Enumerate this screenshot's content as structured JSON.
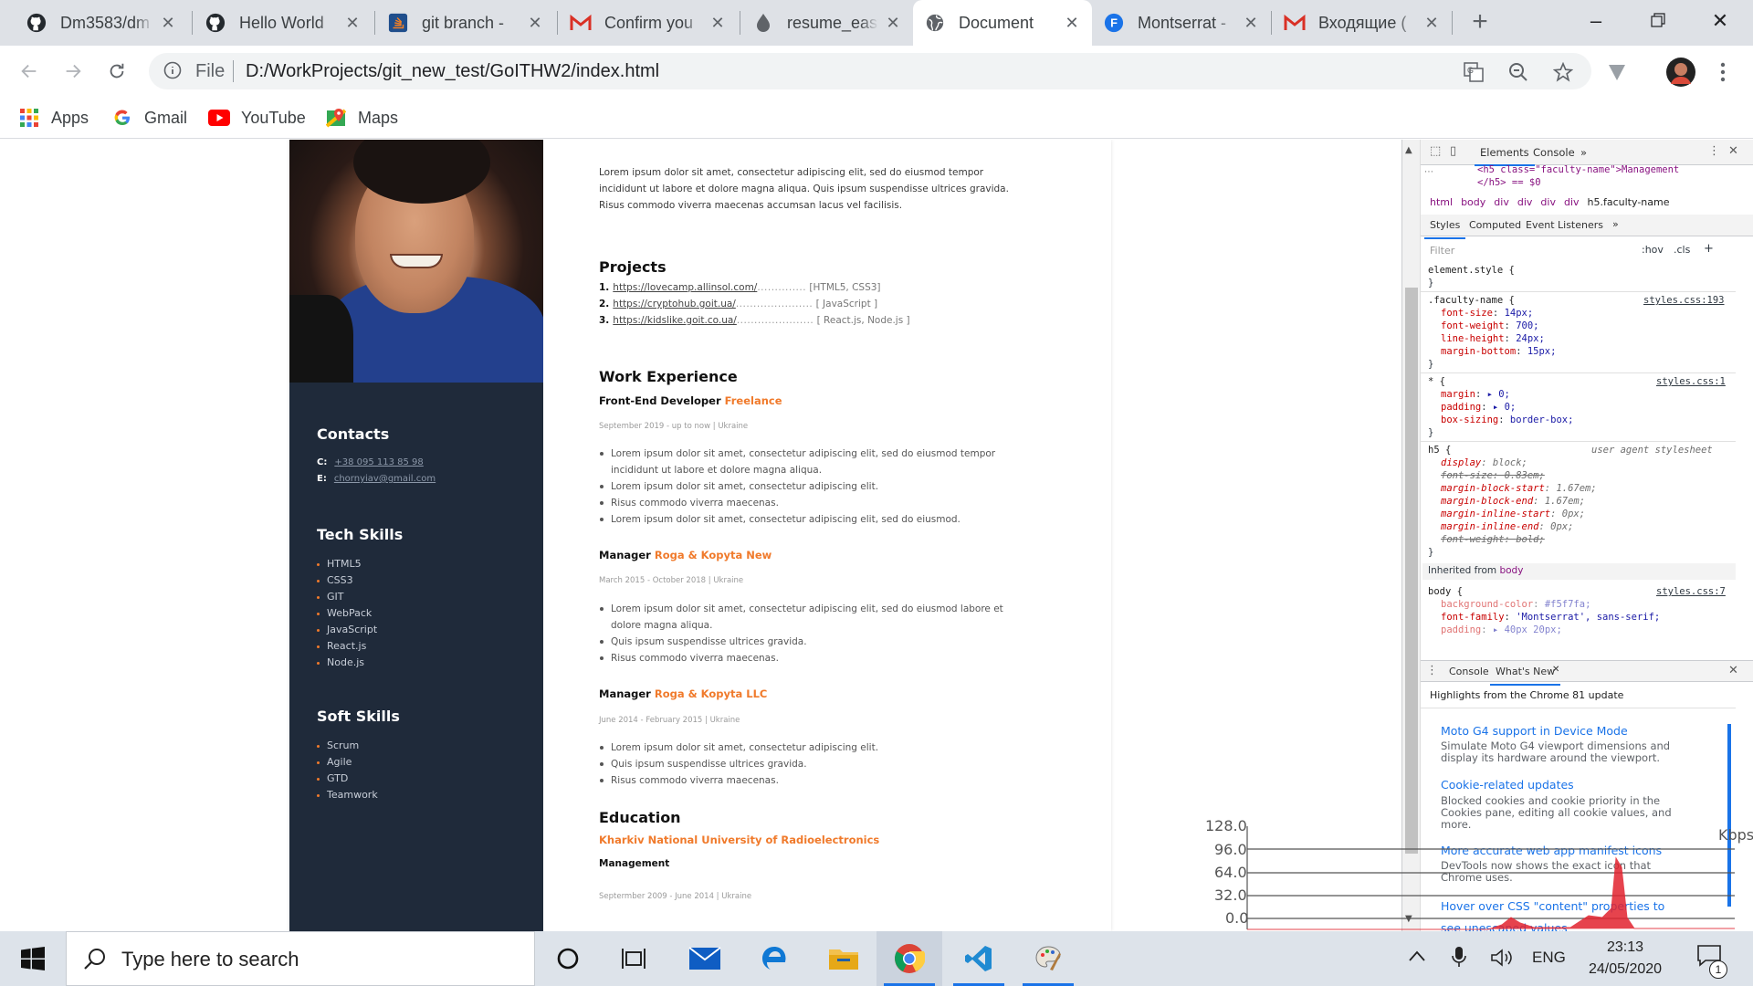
{
  "tabs": [
    {
      "title": "Dm3583/dm",
      "icon": "github-icon"
    },
    {
      "title": "Hello World",
      "icon": "github-icon"
    },
    {
      "title": "git branch -",
      "icon": "stackoverflow-icon"
    },
    {
      "title": "Confirm you",
      "icon": "gmail-icon"
    },
    {
      "title": "resume_easy",
      "icon": "drop-icon"
    },
    {
      "title": "Document",
      "icon": "globe-icon",
      "active": true
    },
    {
      "title": "Montserrat -",
      "icon": "fonts-icon"
    },
    {
      "title": "Входящие (",
      "icon": "gmail-icon"
    }
  ],
  "address": {
    "scheme": "File",
    "url": "D:/WorkProjects/git_new_test/GoITHW2/index.html"
  },
  "bookmarks": [
    {
      "label": "Apps",
      "icon": "apps-grid-icon"
    },
    {
      "label": "Gmail",
      "icon": "google-icon"
    },
    {
      "label": "YouTube",
      "icon": "youtube-icon"
    },
    {
      "label": "Maps",
      "icon": "maps-icon"
    }
  ],
  "resume": {
    "intro": "Lorem ipsum dolor sit amet, consectetur adipiscing elit, sed do eiusmod tempor incididunt ut labore et dolore magna aliqua. Quis ipsum suspendisse ultrices gravida. Risus commodo viverra maecenas accumsan lacus vel facilisis.",
    "contacts_title": "Contacts",
    "contacts": [
      {
        "key": "C:",
        "value": "+38 095 113 85 98"
      },
      {
        "key": "E:",
        "value": "chornyiav@gmail.com"
      }
    ],
    "tech_title": "Tech Skills",
    "tech_skills": [
      "HTML5",
      "CSS3",
      "GIT",
      "WebPack",
      "JavaScript",
      "React.js",
      "Node.js"
    ],
    "soft_title": "Soft Skills",
    "soft_skills": [
      "Scrum",
      "Agile",
      "GTD",
      "Teamwork"
    ],
    "projects_title": "Projects",
    "projects": [
      {
        "num": "1.",
        "url": "https://lovecamp.allinsol.com/",
        "dots": "..............",
        "tech": "[HTML5, CSS3]"
      },
      {
        "num": "2.",
        "url": "https://cryptohub.goit.ua/",
        "dots": "......................",
        "tech": "[ JavaScript ]"
      },
      {
        "num": "3.",
        "url": "https://kidslike.goit.co.ua/",
        "dots": "......................",
        "tech": "[ React.js, Node.js ]"
      }
    ],
    "work_title": "Work Experience",
    "jobs": [
      {
        "role": "Front-End Developer",
        "company": "Freelance",
        "meta": "September 2019 - up to now | Ukraine",
        "bullets": [
          "Lorem ipsum dolor sit amet, consectetur adipiscing elit, sed do eiusmod tempor incididunt ut labore et dolore magna aliqua.",
          "Lorem ipsum dolor sit amet, consectetur adipiscing elit.",
          "Risus commodo viverra maecenas.",
          "Lorem ipsum dolor sit amet, consectetur adipiscing elit, sed do eiusmod."
        ]
      },
      {
        "role": "Manager",
        "company": "Roga & Kopyta New",
        "meta": "March 2015 - October 2018 | Ukraine",
        "bullets": [
          "Lorem ipsum dolor sit amet, consectetur adipiscing elit, sed do eiusmod labore et dolore magna aliqua.",
          "Quis ipsum suspendisse ultrices gravida.",
          "Risus commodo viverra maecenas."
        ]
      },
      {
        "role": "Manager",
        "company": "Roga & Kopyta LLC",
        "meta": "June 2014 - February 2015 | Ukraine",
        "bullets": [
          "Lorem ipsum dolor sit amet, consectetur adipiscing elit.",
          "Quis ipsum suspendisse ultrices gravida.",
          "Risus commodo viverra maecenas."
        ]
      }
    ],
    "education_title": "Education",
    "education": {
      "school": "Kharkiv National University of Radioelectronics",
      "degree": "Management",
      "meta": "Septermber 2009 - June 2014 | Ukraine"
    }
  },
  "devtools": {
    "tabs": [
      "Elements",
      "Console"
    ],
    "dom_line1": "<h5 class=\"faculty-name\">Management",
    "dom_line2": "</h5> == $0",
    "breadcrumbs": [
      "html",
      "body",
      "div",
      "div",
      "div",
      "div",
      "h5.faculty-name"
    ],
    "style_tabs": [
      "Styles",
      "Computed",
      "Event Listeners"
    ],
    "filter_placeholder": "Filter",
    "hov": ":hov",
    "cls": ".cls",
    "element_style": "element.style {",
    "rules": [
      {
        "selector": ".faculty-name {",
        "source": "styles.css:193",
        "props": [
          [
            "font-size",
            "14px;"
          ],
          [
            "font-weight",
            "700;"
          ],
          [
            "line-height",
            "24px;"
          ],
          [
            "margin-bottom",
            "15px;"
          ]
        ]
      },
      {
        "selector": "* {",
        "source": "styles.css:1",
        "props": [
          [
            "margin",
            "▸ 0;"
          ],
          [
            "padding",
            "▸ 0;"
          ],
          [
            "box-sizing",
            "border-box;"
          ]
        ]
      }
    ],
    "ua_rule": {
      "selector": "h5 {",
      "source": "user agent stylesheet",
      "props": [
        [
          "display",
          "block;",
          false
        ],
        [
          "font-size",
          "0.83em;",
          true
        ],
        [
          "margin-block-start",
          "1.67em;",
          false
        ],
        [
          "margin-block-end",
          "1.67em;",
          false
        ],
        [
          "margin-inline-start",
          "0px;",
          false
        ],
        [
          "margin-inline-end",
          "0px;",
          false
        ],
        [
          "font-weight",
          "bold;",
          true
        ]
      ]
    },
    "inherited_label": "Inherited from",
    "inherited_from": "body",
    "body_rule": {
      "selector": "body {",
      "source": "styles.css:7",
      "props": [
        [
          "background-color",
          "#f5f7fa;"
        ],
        [
          "font-family",
          "'Montserrat', sans-serif;"
        ],
        [
          "padding",
          "▸ 40px 20px;"
        ]
      ]
    },
    "drawer_tabs": [
      "Console",
      "What's New"
    ],
    "whats_new_header": "Highlights from the Chrome 81 update",
    "whats_new": [
      {
        "title": "Moto G4 support in Device Mode",
        "desc": "Simulate Moto G4 viewport dimensions and display its hardware around the viewport."
      },
      {
        "title": "Cookie-related updates",
        "desc": "Blocked cookies and cookie priority in the Cookies pane, editing all cookie values, and more."
      },
      {
        "title": "More accurate web app manifest icons",
        "desc": "DevTools now shows the exact icon that Chrome uses."
      },
      {
        "title": "Hover over CSS \"content\" properties to see unescaped values",
        "desc": ""
      }
    ]
  },
  "perf_overlay": {
    "labels": [
      "128.0",
      "96.0",
      "64.0",
      "32.0",
      "0.0"
    ],
    "unit": "Kbps"
  },
  "taskbar": {
    "search_placeholder": "Type here to search",
    "language": "ENG",
    "time": "23:13",
    "date": "24/05/2020",
    "notification_count": "1"
  }
}
